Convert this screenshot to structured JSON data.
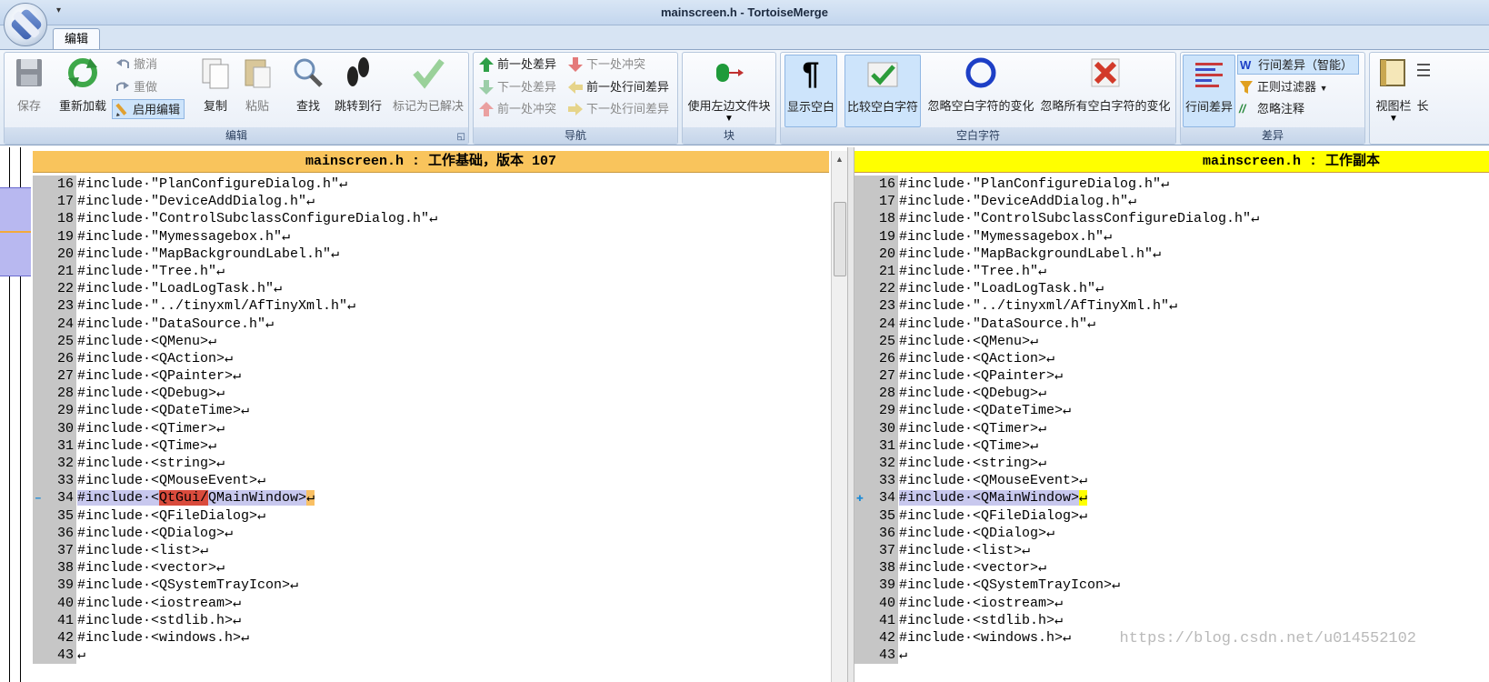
{
  "window": {
    "title": "mainscreen.h - TortoiseMerge",
    "qat_arrow": "▾"
  },
  "tabs": [
    {
      "label": "编辑",
      "active": true
    }
  ],
  "ribbon": {
    "edit": {
      "label": "编辑",
      "save": "保存",
      "reload": "重新加载",
      "undo": "撤消",
      "redo": "重做",
      "enable_edit": "启用编辑",
      "copy": "复制",
      "paste": "粘贴",
      "find": "查找",
      "goto_line": "跳转到行",
      "mark_resolved": "标记为已解决"
    },
    "nav": {
      "label": "导航",
      "prev_diff": "前一处差异",
      "next_diff": "下一处差异",
      "prev_conflict": "前一处冲突",
      "next_conflict": "下一处冲突",
      "prev_inline_diff": "前一处行间差异",
      "next_inline_diff": "下一处行间差异"
    },
    "block": {
      "label": "块",
      "use_left": "使用左边文件块"
    },
    "whitespace": {
      "label": "空白字符",
      "show_ws": "显示空白",
      "compare_ws": "比较空白字符",
      "ignore_ws_changes": "忽略空白字符的变化",
      "ignore_all_ws": "忽略所有空白字符的变化"
    },
    "diff": {
      "label": "差异",
      "inline_diff": "行间差异",
      "inline_diff_smart": "行间差异（智能）",
      "regex_filter": "正则过滤器",
      "ignore_comments": "忽略注释"
    },
    "view": {
      "view_bar": "视图栏",
      "partial": "长"
    }
  },
  "left_pane": {
    "header": "mainscreen.h : 工作基础，版本 107",
    "changed_line": {
      "num": "34",
      "marker": "–",
      "prefix": "#include·<",
      "deleted": "QtGui/",
      "rest": "QMainWindow>",
      "eol": "↵"
    }
  },
  "right_pane": {
    "header": "mainscreen.h : 工作副本",
    "changed_line": {
      "num": "34",
      "marker": "✚",
      "prefix": "#include·<",
      "rest": "QMainWindow>",
      "eol": "↵"
    }
  },
  "lines_before": [
    {
      "num": "16",
      "text": "#include·\"PlanConfigureDialog.h\"↵"
    },
    {
      "num": "17",
      "text": "#include·\"DeviceAddDialog.h\"↵"
    },
    {
      "num": "18",
      "text": "#include·\"ControlSubclassConfigureDialog.h\"↵"
    },
    {
      "num": "19",
      "text": "#include·\"Mymessagebox.h\"↵"
    },
    {
      "num": "20",
      "text": "#include·\"MapBackgroundLabel.h\"↵"
    },
    {
      "num": "21",
      "text": "#include·\"Tree.h\"↵"
    },
    {
      "num": "22",
      "text": "#include·\"LoadLogTask.h\"↵"
    },
    {
      "num": "23",
      "text": "#include·\"../tinyxml/AfTinyXml.h\"↵"
    },
    {
      "num": "24",
      "text": "#include·\"DataSource.h\"↵"
    },
    {
      "num": "25",
      "text": "#include·<QMenu>↵"
    },
    {
      "num": "26",
      "text": "#include·<QAction>↵"
    },
    {
      "num": "27",
      "text": "#include·<QPainter>↵"
    },
    {
      "num": "28",
      "text": "#include·<QDebug>↵"
    },
    {
      "num": "29",
      "text": "#include·<QDateTime>↵"
    },
    {
      "num": "30",
      "text": "#include·<QTimer>↵"
    },
    {
      "num": "31",
      "text": "#include·<QTime>↵"
    },
    {
      "num": "32",
      "text": "#include·<string>↵"
    },
    {
      "num": "33",
      "text": "#include·<QMouseEvent>↵"
    }
  ],
  "lines_after": [
    {
      "num": "35",
      "text": "#include·<QFileDialog>↵"
    },
    {
      "num": "36",
      "text": "#include·<QDialog>↵"
    },
    {
      "num": "37",
      "text": "#include·<list>↵"
    },
    {
      "num": "38",
      "text": "#include·<vector>↵"
    },
    {
      "num": "39",
      "text": "#include·<QSystemTrayIcon>↵"
    },
    {
      "num": "40",
      "text": "#include·<iostream>↵"
    },
    {
      "num": "41",
      "text": "#include·<stdlib.h>↵"
    },
    {
      "num": "42",
      "text": "#include·<windows.h>↵"
    },
    {
      "num": "43",
      "text": "↵"
    }
  ],
  "watermark": "https://blog.csdn.net/u014552102",
  "colors": {
    "base_header": "#f9c45c",
    "mine_header": "#ffff00",
    "deleted": "#d94b3c",
    "changed_old": "#f9c064",
    "changed_new": "#ffff00"
  }
}
